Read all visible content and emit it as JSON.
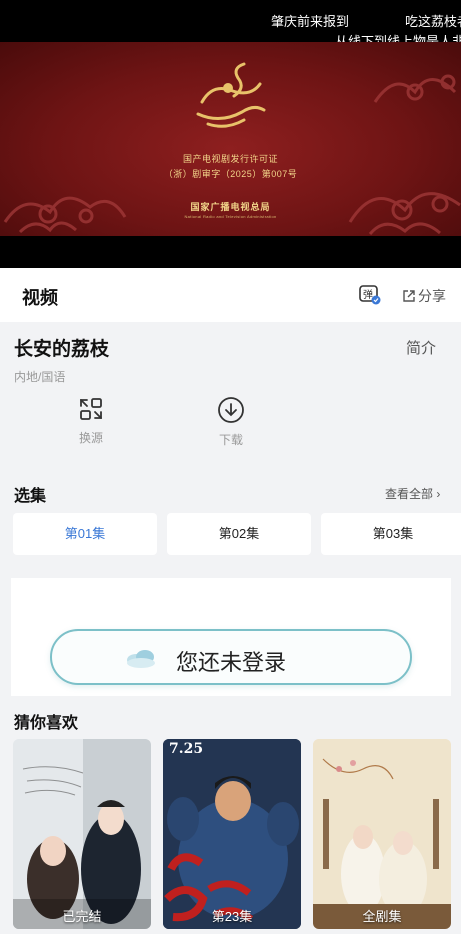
{
  "player": {
    "danmaku": [
      "肇庆前来报到",
      "吃这荔枝者",
      "从线下到线上物是人非"
    ],
    "license_title": "国产电视剧发行许可证",
    "license_number": "（浙）剧审字（2025）第007号",
    "admin_name": "国家广播电视总局",
    "admin_name_en": "National Radio and Television Administration"
  },
  "header": {
    "title": "视频",
    "share_label": "分享",
    "danmaku_icon": "danmaku-settings-icon"
  },
  "show": {
    "title": "长安的荔枝",
    "intro_label": "简介",
    "meta": "内地/国语",
    "actions": [
      {
        "label": "换源",
        "icon": "switch-source-icon"
      },
      {
        "label": "下载",
        "icon": "download-icon"
      }
    ]
  },
  "episodes": {
    "title": "选集",
    "view_all": "查看全部",
    "items": [
      {
        "label": "第01集",
        "active": true
      },
      {
        "label": "第02集",
        "active": false
      },
      {
        "label": "第03集",
        "active": false
      }
    ]
  },
  "login": {
    "text": "您还未登录"
  },
  "recommend": {
    "title": "猜你喜欢",
    "items": [
      {
        "badge": "已完结"
      },
      {
        "badge": "第23集",
        "date": "7.25"
      },
      {
        "badge": "全剧集"
      }
    ]
  },
  "colors": {
    "accent": "#3a78d6",
    "player_red": "#7a1515",
    "gold": "#f2d58a",
    "login_border": "#7cc0c8"
  }
}
